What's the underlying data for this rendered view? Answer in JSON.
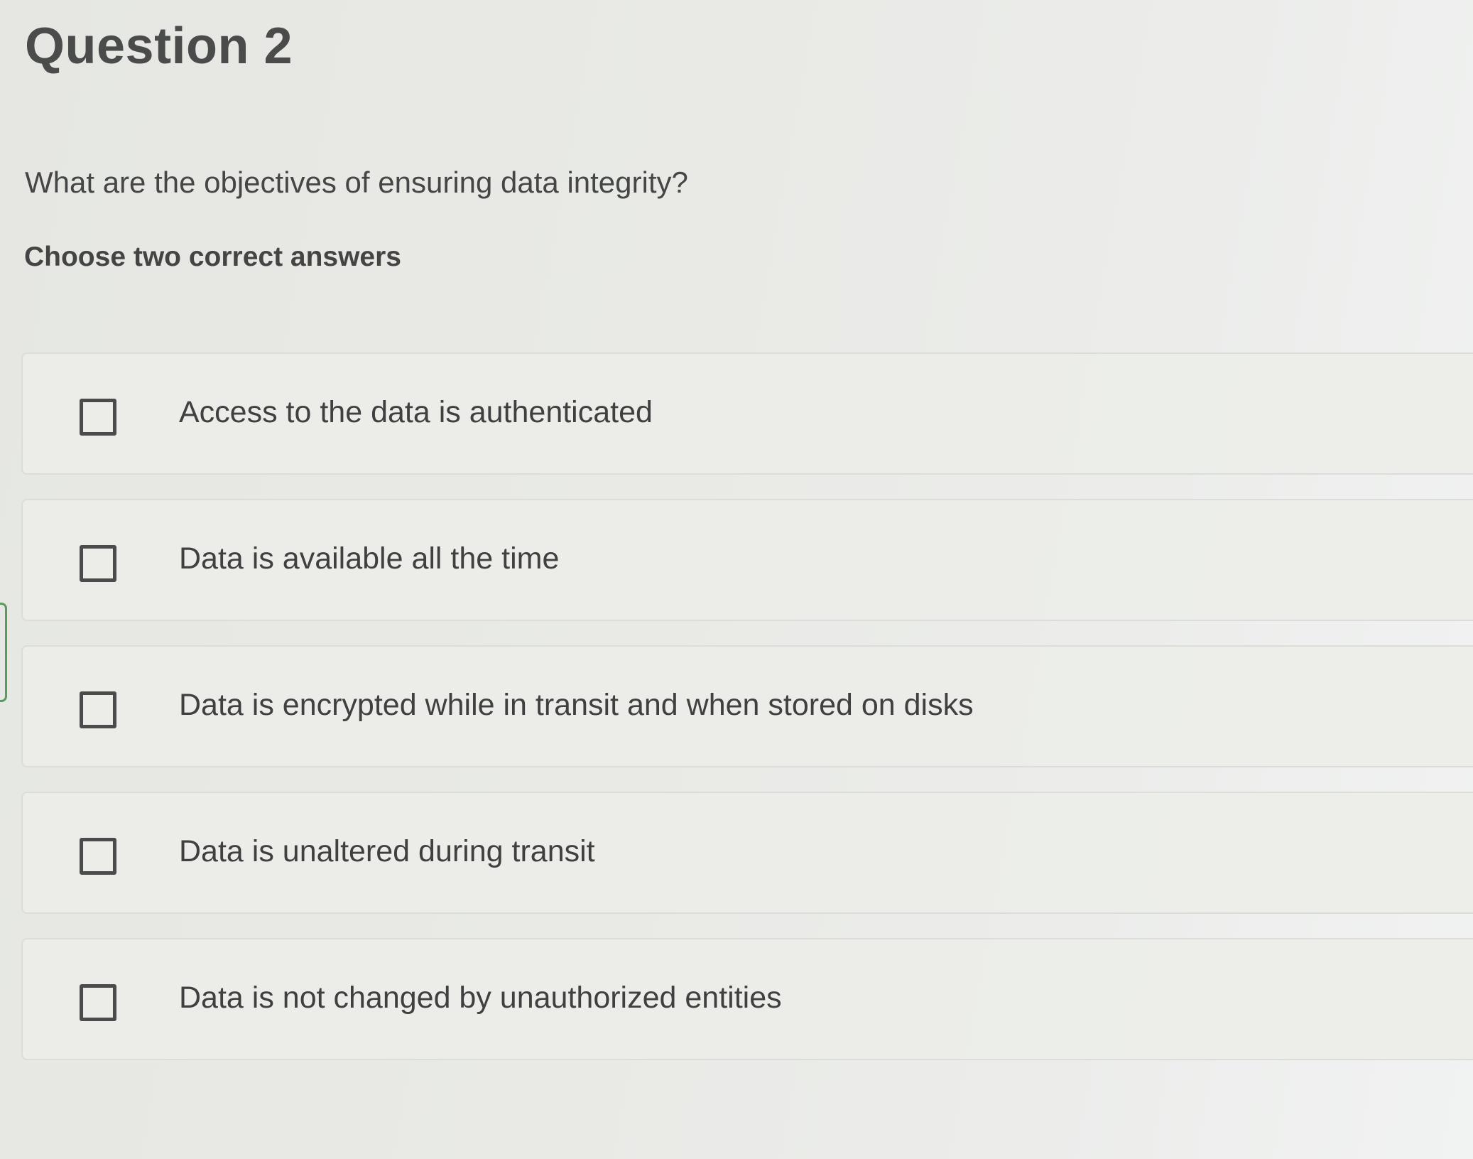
{
  "question": {
    "title": "Question 2",
    "prompt": "What are the objectives of ensuring data integrity?",
    "instruction": "Choose two correct answers"
  },
  "options": [
    {
      "label": "Access to the data is authenticated",
      "checked": false
    },
    {
      "label": "Data is available all the time",
      "checked": false
    },
    {
      "label": "Data is encrypted while in transit and when stored on disks",
      "checked": false
    },
    {
      "label": "Data is unaltered during transit",
      "checked": false
    },
    {
      "label": "Data is not changed by unauthorized entities",
      "checked": false
    }
  ]
}
